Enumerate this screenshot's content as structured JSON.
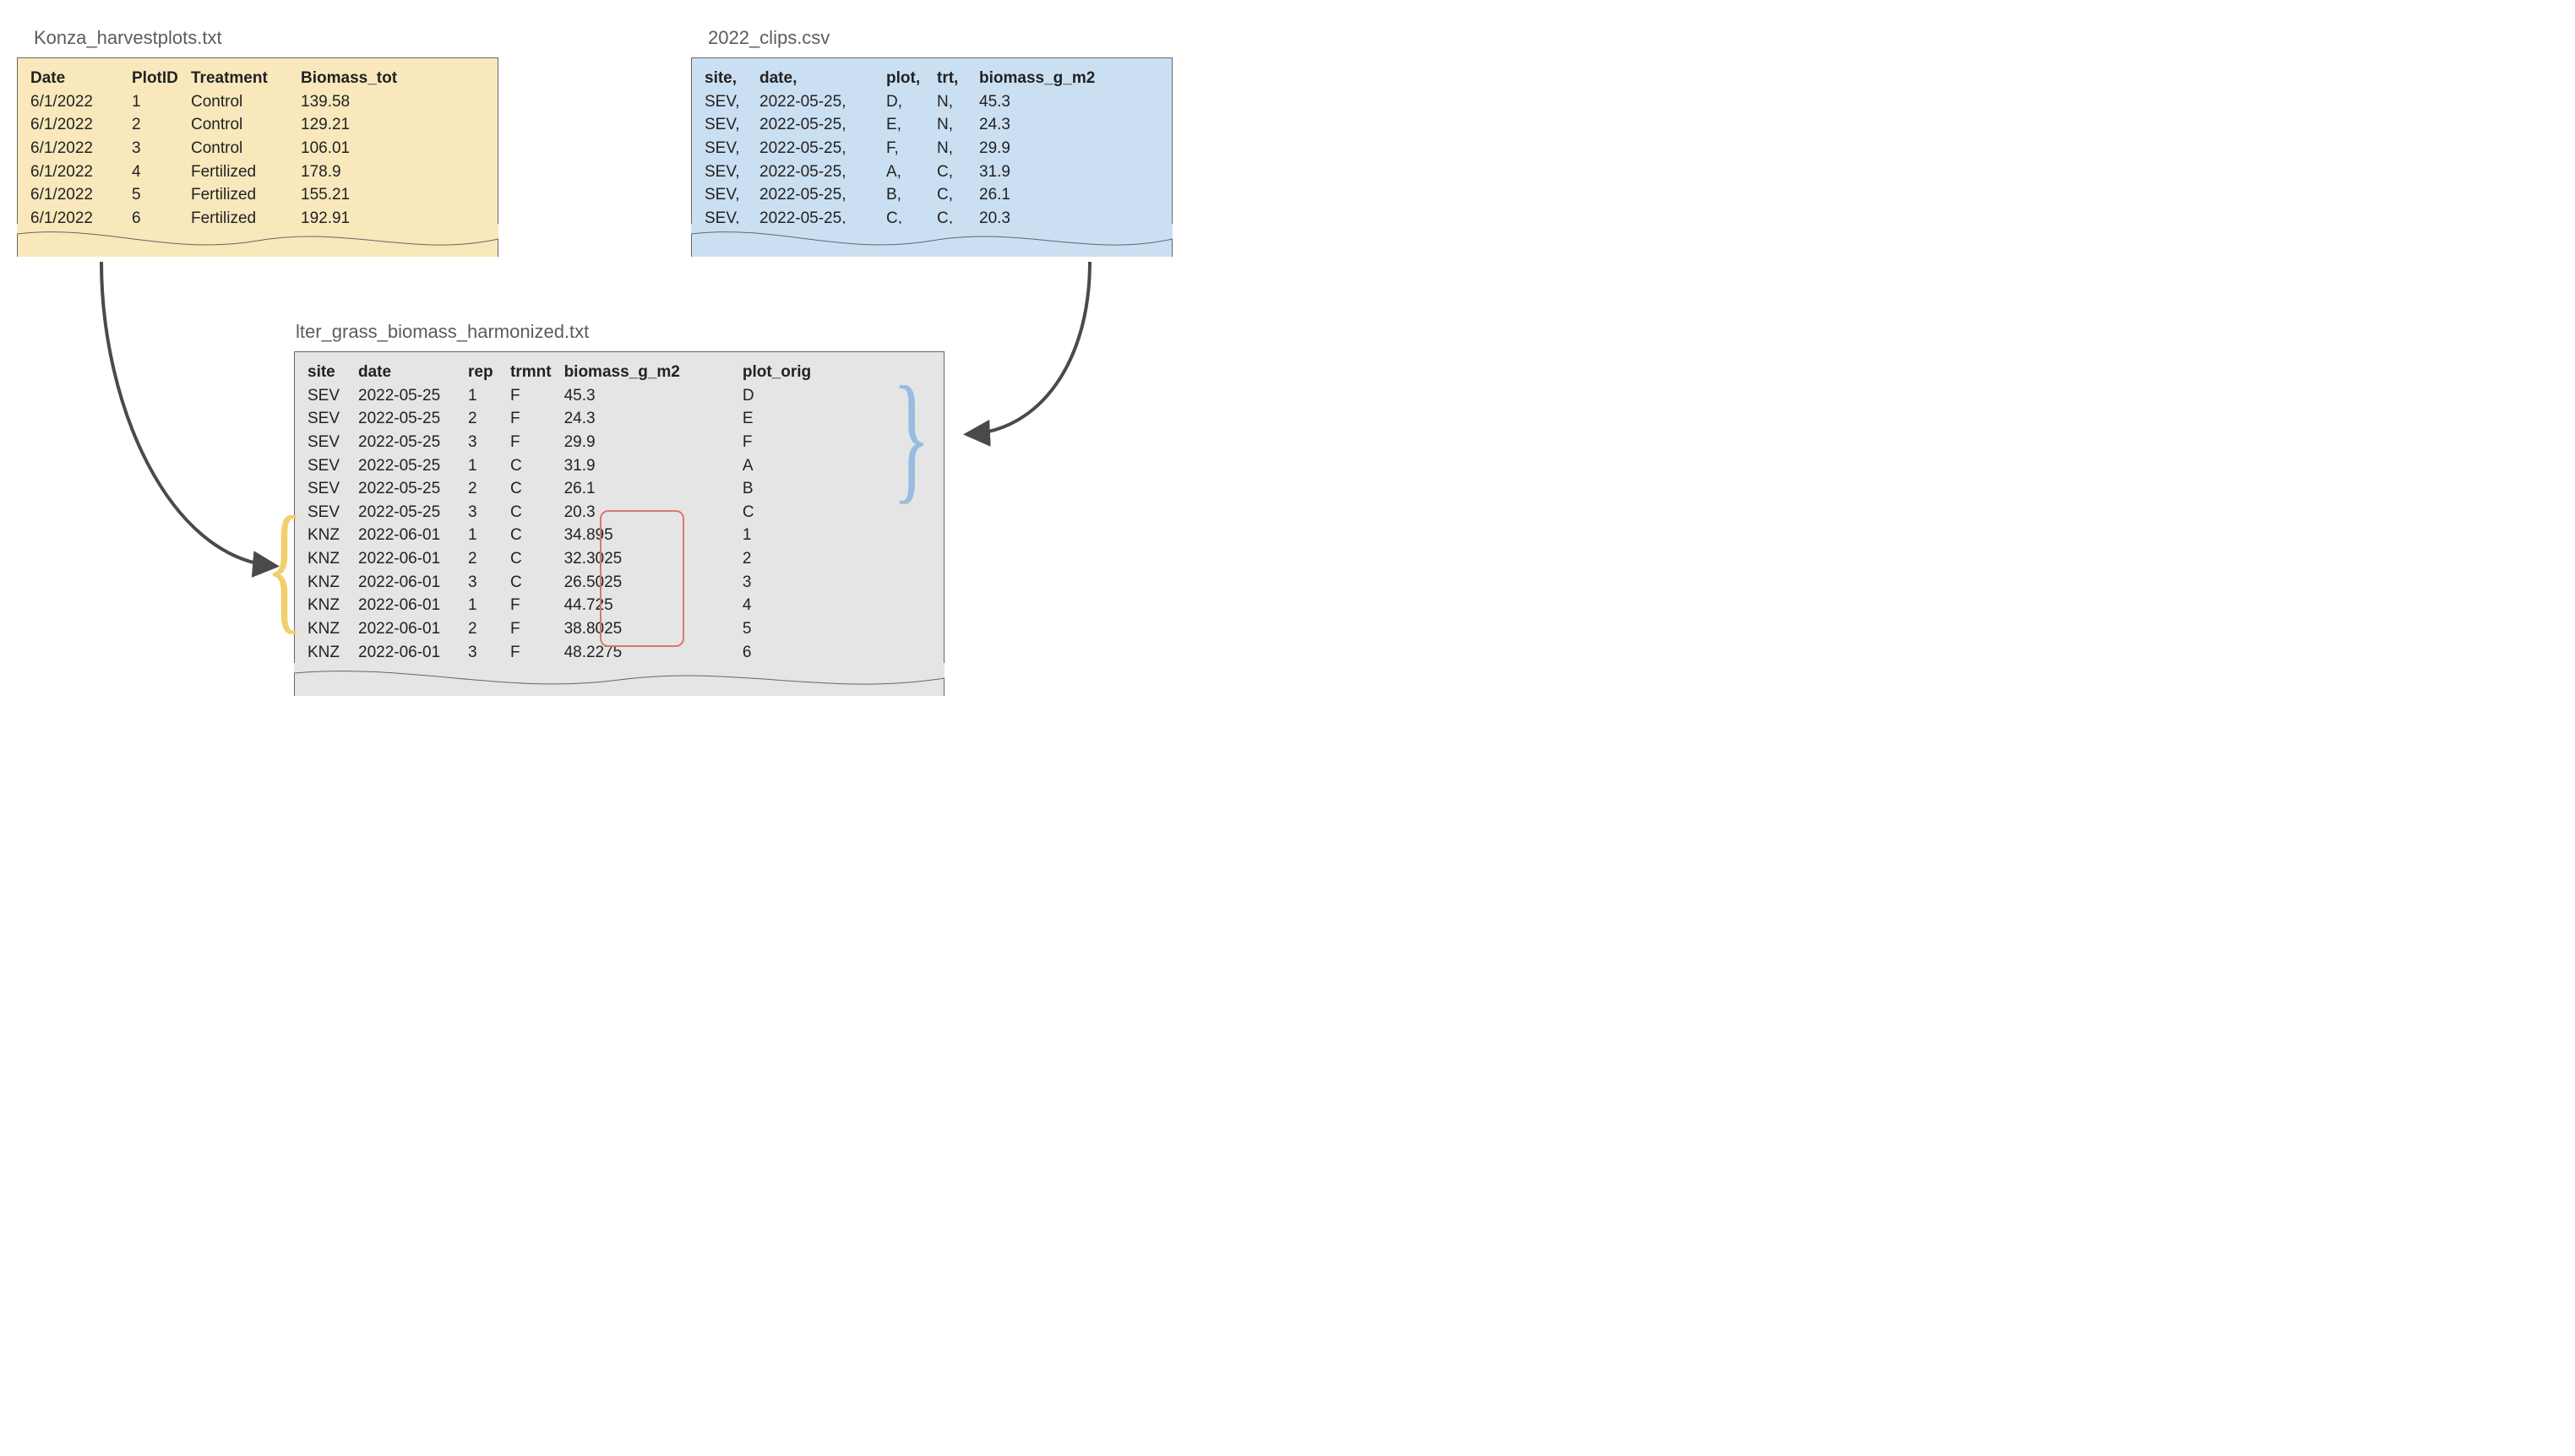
{
  "top_left": {
    "filename": "Konza_harvestplots.txt",
    "headers": [
      "Date",
      "PlotID",
      "Treatment",
      "Biomass_tot"
    ],
    "rows": [
      [
        "6/1/2022",
        "1",
        "Control",
        "139.58"
      ],
      [
        "6/1/2022",
        "2",
        "Control",
        "129.21"
      ],
      [
        "6/1/2022",
        "3",
        "Control",
        "106.01"
      ],
      [
        "6/1/2022",
        "4",
        "Fertilized",
        "178.9"
      ],
      [
        "6/1/2022",
        "5",
        "Fertilized",
        "155.21"
      ],
      [
        "6/1/2022",
        "6",
        "Fertilized",
        "192.91"
      ]
    ]
  },
  "top_right": {
    "filename": "2022_clips.csv",
    "headers": [
      "site,",
      "date,",
      "plot,",
      "trt,",
      "biomass_g_m2"
    ],
    "rows": [
      [
        "SEV,",
        "2022-05-25,",
        "D,",
        "N,",
        "45.3"
      ],
      [
        "SEV,",
        "2022-05-25,",
        "E,",
        "N,",
        "24.3"
      ],
      [
        "SEV,",
        "2022-05-25,",
        "F,",
        "N,",
        "29.9"
      ],
      [
        "SEV,",
        "2022-05-25,",
        "A,",
        "C,",
        "31.9"
      ],
      [
        "SEV,",
        "2022-05-25,",
        "B,",
        "C,",
        "26.1"
      ],
      [
        "SEV,",
        "2022-05-25,",
        "C,",
        "C,",
        "20.3"
      ]
    ]
  },
  "bottom": {
    "filename": "lter_grass_biomass_harmonized.txt",
    "headers": [
      "site",
      "date",
      "rep",
      "trmnt",
      "biomass_g_m2",
      "plot_orig"
    ],
    "rows": [
      [
        "SEV",
        "2022-05-25",
        "1",
        "F",
        "45.3",
        "D"
      ],
      [
        "SEV",
        "2022-05-25",
        "2",
        "F",
        "24.3",
        "E"
      ],
      [
        "SEV",
        "2022-05-25",
        "3",
        "F",
        "29.9",
        "F"
      ],
      [
        "SEV",
        "2022-05-25",
        "1",
        "C",
        "31.9",
        "A"
      ],
      [
        "SEV",
        "2022-05-25",
        "2",
        "C",
        "26.1",
        "B"
      ],
      [
        "SEV",
        "2022-05-25",
        "3",
        "C",
        "20.3",
        "C"
      ],
      [
        "KNZ",
        "2022-06-01",
        "1",
        "C",
        "34.895",
        "1"
      ],
      [
        "KNZ",
        "2022-06-01",
        "2",
        "C",
        "32.3025",
        "2"
      ],
      [
        "KNZ",
        "2022-06-01",
        "3",
        "C",
        "26.5025",
        "3"
      ],
      [
        "KNZ",
        "2022-06-01",
        "1",
        "F",
        "44.725",
        "4"
      ],
      [
        "KNZ",
        "2022-06-01",
        "2",
        "F",
        "38.8025",
        "5"
      ],
      [
        "KNZ",
        "2022-06-01",
        "3",
        "F",
        "48.2275",
        "6"
      ]
    ]
  },
  "colors": {
    "yellow_bg": "#f8e8bc",
    "blue_bg": "#cbdff2",
    "grey_bg": "#e5e5e5",
    "arrow": "#4a4a4a",
    "highlight_border": "#d9786b",
    "brace_yellow": "#f1cf6d",
    "brace_blue": "#97bce0"
  }
}
